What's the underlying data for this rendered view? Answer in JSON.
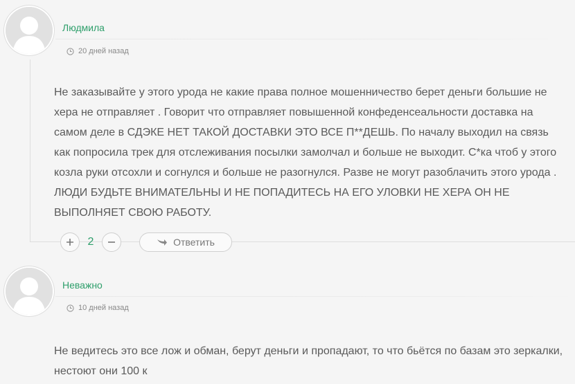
{
  "comments": [
    {
      "author": "Людмила",
      "date": "20 дней назад",
      "text": "Не заказывайте у этого урода не какие права полное мошенничество берет деньги большие не хера не отправляет . Говорит что отправляет повышенной конфеденсеальности доставка на самом деле в СДЭКЕ НЕТ ТАКОЙ ДОСТАВКИ ЭТО ВСЕ П**ДЕШЬ. По началу выходил на связь как попросила трек для отслеживания посылки замолчал и больше не выходит. С*ка чтоб у этого козла руки отсохли и согнулся и больше не разогнулся. Разве не могут разоблачить этого урода . ЛЮДИ БУДЬТЕ ВНИМАТЕЛЬНЫ И НЕ ПОПАДИТЕСЬ НА ЕГО УЛОВКИ НЕ ХЕРА ОН НЕ ВЫПОЛНЯЕТ СВОЮ РАБОТУ.",
      "vote_count": "2",
      "reply_label": "Ответить"
    },
    {
      "author": "Неважно",
      "date": "10 дней назад",
      "text": "Не ведитесь это все лож и обман, берут деньги и пропадают, то что бьётся по базам это зеркалки, нестоют они 100 к"
    }
  ],
  "icons": {
    "avatar": "user-avatar-placeholder",
    "clock": "clock-icon",
    "plus": "plus-icon",
    "minus": "minus-icon",
    "reply": "reply-arrow-icon"
  },
  "colors": {
    "author": "#2d9e6a",
    "text": "#5a5a5a",
    "background": "#f5f5f5"
  }
}
